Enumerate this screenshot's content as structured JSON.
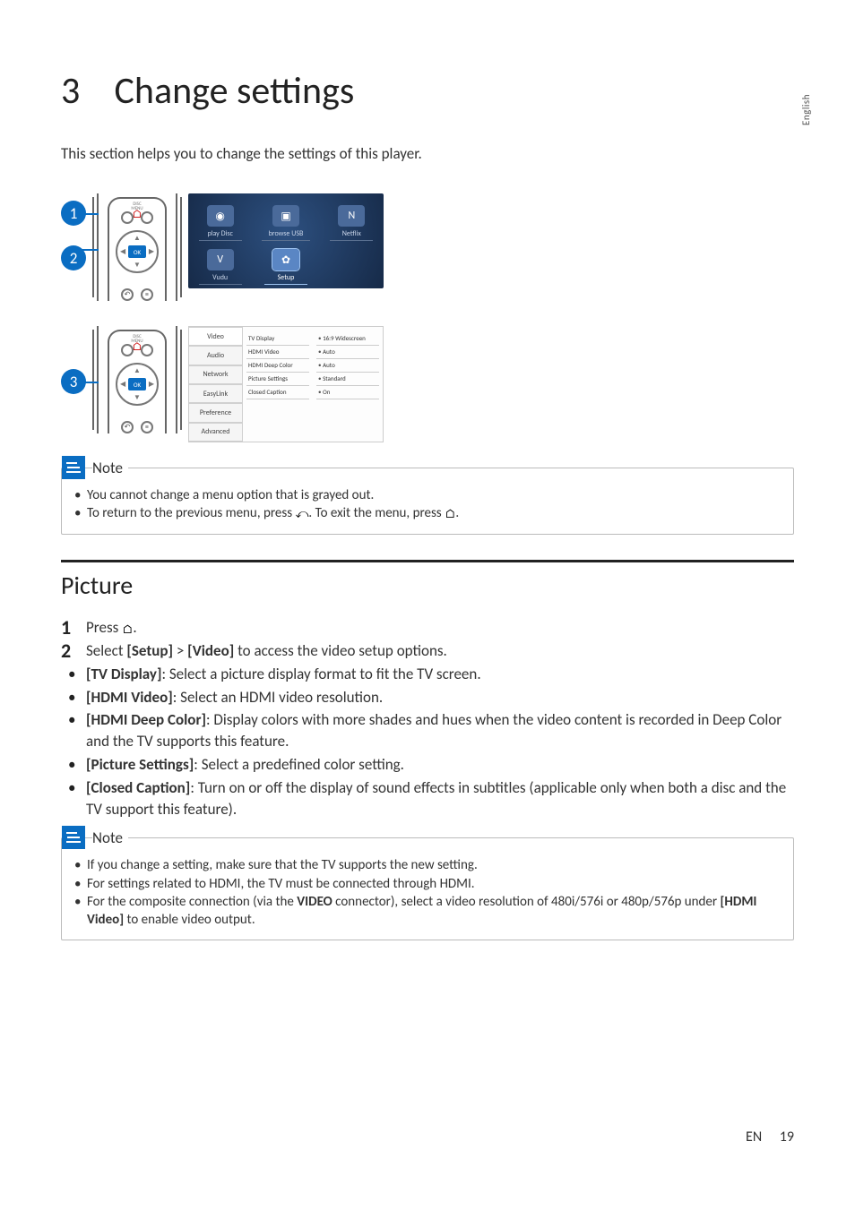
{
  "language_tab": "English",
  "chapter_number": "3",
  "chapter_title": "Change settings",
  "intro_text": "This section helps you to change the settings of this player.",
  "step_numbers": [
    "1",
    "2",
    "3"
  ],
  "home_tiles": [
    {
      "label": "play Disc"
    },
    {
      "label": "browse USB"
    },
    {
      "label": "Netflix"
    },
    {
      "label": "Vudu"
    },
    {
      "label": "Setup",
      "selected": true
    },
    {
      "label": ""
    }
  ],
  "settings": {
    "tabs": [
      "Video",
      "Audio",
      "Network",
      "EasyLink",
      "Preference",
      "Advanced"
    ],
    "active_tab": "Video",
    "options": [
      "TV Display",
      "HDMI Video",
      "HDMI Deep Color",
      "Picture Settings",
      "Closed Caption"
    ],
    "values": [
      "16:9 Widescreen",
      "Auto",
      "Auto",
      "Standard",
      "On"
    ]
  },
  "note1": {
    "title": "Note",
    "items": [
      "You cannot change a menu option that is grayed out.",
      "To return to the previous menu, press __BACK__. To exit the menu, press __HOME__."
    ]
  },
  "section_title": "Picture",
  "picture_steps": [
    {
      "type": "num",
      "num": "1",
      "text": "Press __HOME__."
    },
    {
      "type": "num",
      "num": "2",
      "text_parts": [
        "Select ",
        "[Setup]",
        " > ",
        "[Video]",
        " to access the video setup options."
      ]
    },
    {
      "type": "bul",
      "text_parts": [
        "",
        "[TV Display]",
        ": Select a picture display format to fit the TV screen."
      ]
    },
    {
      "type": "bul",
      "text_parts": [
        "",
        "[HDMI Video]",
        ": Select an HDMI video resolution."
      ]
    },
    {
      "type": "bul",
      "text_parts": [
        "",
        "[HDMI Deep Color]",
        ": Display colors with more shades and hues when the video content is recorded in Deep Color and the TV supports this feature."
      ]
    },
    {
      "type": "bul",
      "text_parts": [
        "",
        "[Picture Settings]",
        ": Select a predefined color setting."
      ]
    },
    {
      "type": "bul",
      "text_parts": [
        "",
        "[Closed Caption]",
        ": Turn on or off the display of sound effects in subtitles (applicable only when both a disc and the TV support this feature)."
      ]
    }
  ],
  "note2": {
    "title": "Note",
    "items": [
      "If you change a setting, make sure that the TV supports the new setting.",
      "For settings related to HDMI, the TV must be connected through HDMI.",
      "For the composite connection (via the __B__VIDEO__B__ connector), select a video resolution of 480i/576i or 480p/576p under __B__[HDMI Video]__B__ to enable video output."
    ]
  },
  "footer": {
    "lang": "EN",
    "page": "19"
  }
}
